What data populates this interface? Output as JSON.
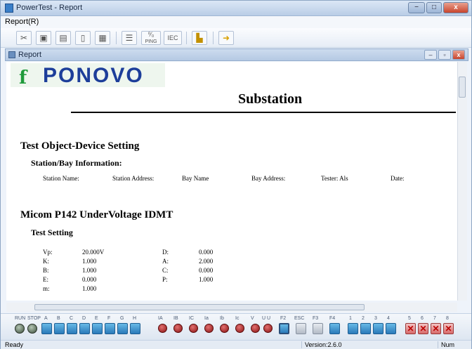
{
  "window": {
    "title": "PowerTest - Report",
    "min": "−",
    "max": "□",
    "close": "x"
  },
  "menu": {
    "report": "Report(R)"
  },
  "toolbar": {
    "ping": "PING",
    "iec": "IEC"
  },
  "child": {
    "title": "Report",
    "min": "–",
    "max": "▫",
    "close": "x"
  },
  "report": {
    "logo_mark": "f",
    "logo_text": "PONOVO",
    "heading": "Substation",
    "section1": "Test Object-Device Setting",
    "sub1": "Station/Bay Information:",
    "fields": [
      "Station Name:",
      "Station Address:",
      "Bay Name",
      "Bay Address:",
      "Tester: Als",
      "Date:"
    ],
    "section2": "Micom P142 UnderVoltage IDMT",
    "sub2": "Test Setting",
    "settings_left": [
      {
        "k": "Vp:",
        "v": "20.000V"
      },
      {
        "k": "K:",
        "v": "1.000"
      },
      {
        "k": "B:",
        "v": "1.000"
      },
      {
        "k": "E:",
        "v": "0.000"
      },
      {
        "k": "m:",
        "v": "1.000"
      }
    ],
    "settings_right": [
      {
        "k": "D:",
        "v": "0.000"
      },
      {
        "k": "A:",
        "v": "2.000"
      },
      {
        "k": "C:",
        "v": "0.000"
      },
      {
        "k": "P:",
        "v": "1.000"
      }
    ]
  },
  "bottom": {
    "labels": [
      "RUN",
      "STOP",
      "A",
      "B",
      "C",
      "D",
      "E",
      "F",
      "G",
      "H",
      "IA",
      "IB",
      "IC",
      "Ia",
      "Ib",
      "Ic",
      "V",
      "U U",
      "F2",
      "ESC",
      "F3",
      "F4",
      "1",
      "2",
      "3",
      "4",
      "5",
      "6",
      "7",
      "8"
    ]
  },
  "status": {
    "ready": "Ready",
    "version": "Version:2.6.0",
    "num": "Num"
  }
}
